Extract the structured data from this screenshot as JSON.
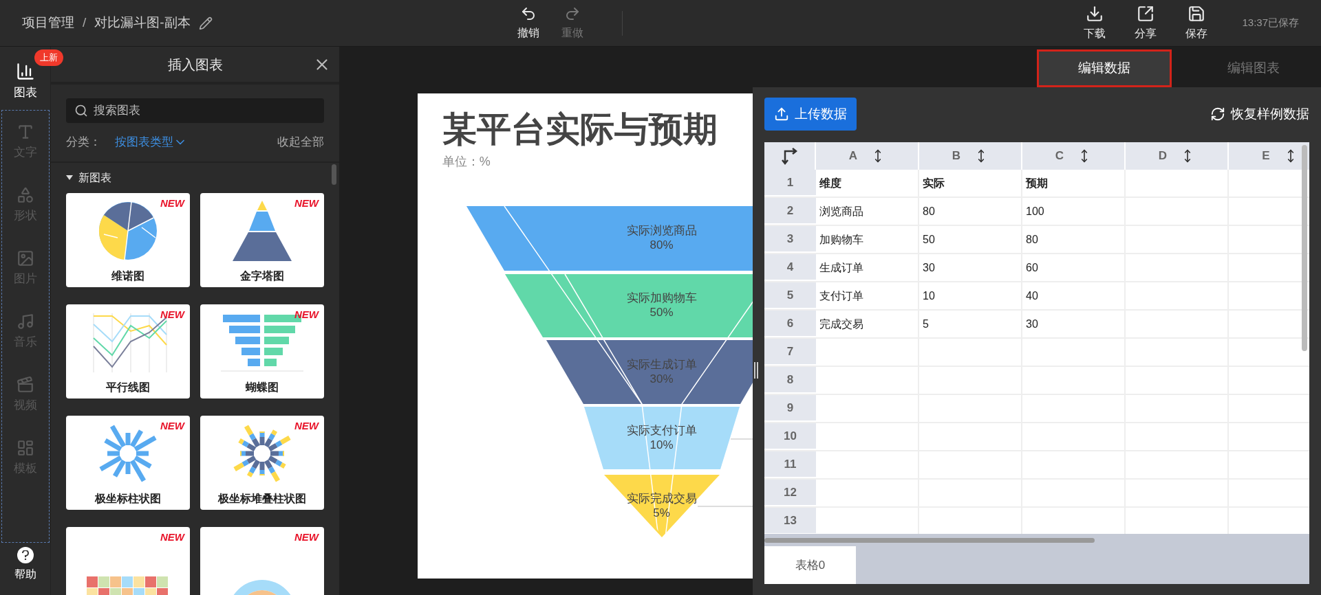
{
  "topbar": {
    "breadcrumb": [
      "项目管理",
      "对比漏斗图-副本"
    ],
    "separator": "/",
    "history": [
      {
        "label": "撤销",
        "disabled": false
      },
      {
        "label": "重做",
        "disabled": true
      }
    ],
    "actions": [
      "下载",
      "分享",
      "保存"
    ],
    "save_status": "13:37已保存"
  },
  "rail": {
    "badge": "上新",
    "items": [
      {
        "label": "图表",
        "selected": true
      },
      {
        "label": "文字",
        "selected": false
      },
      {
        "label": "形状",
        "selected": false
      },
      {
        "label": "图片",
        "selected": false
      },
      {
        "label": "音乐",
        "selected": false
      },
      {
        "label": "视频",
        "selected": false
      },
      {
        "label": "模板",
        "selected": false
      }
    ],
    "help": "帮助"
  },
  "panel": {
    "title": "插入图表",
    "search": {
      "placeholder": "搜索图表"
    },
    "category_label": "分类：",
    "category_value": "按图表类型",
    "collapse_all": "收起全部",
    "section": {
      "title": "新图表",
      "expanded": true,
      "cards": [
        {
          "title": "维诺图",
          "badge": "NEW"
        },
        {
          "title": "金字塔图",
          "badge": "NEW"
        },
        {
          "title": "平行线图",
          "badge": "NEW"
        },
        {
          "title": "蝴蝶图",
          "badge": "NEW"
        },
        {
          "title": "极坐标柱状图",
          "badge": "NEW"
        },
        {
          "title": "极坐标堆叠柱状图",
          "badge": "NEW"
        },
        {
          "badge": "NEW"
        },
        {
          "badge": "NEW"
        }
      ]
    }
  },
  "chart": {
    "title": "某平台实际与预期",
    "unit": "单位：%",
    "stages": [
      {
        "label": "实际浏览商品",
        "value": "80%",
        "color": "#58aaf0"
      },
      {
        "label": "实际加购物车",
        "value": "50%",
        "color": "#61d8a9"
      },
      {
        "label": "实际生成订单",
        "value": "30%",
        "color": "#5a6e99"
      },
      {
        "label": "实际支付订单",
        "value": "10%",
        "color": "#a6dcf9"
      },
      {
        "label": "实际完成交易",
        "value": "5%",
        "color": "#fdd94a"
      }
    ]
  },
  "editor_tabs": [
    {
      "label": "编辑数据",
      "selected": true
    },
    {
      "label": "编辑图表",
      "selected": false
    }
  ],
  "data_panel": {
    "upload": "上传数据",
    "restore": "恢复样例数据",
    "columns": [
      "A",
      "B",
      "C",
      "D",
      "E"
    ],
    "rows": [
      {
        "number": "1",
        "kind": "header",
        "cells": [
          "维度",
          "实际",
          "预期"
        ]
      },
      {
        "number": "2",
        "cells": [
          "浏览商品",
          "80",
          "100"
        ]
      },
      {
        "number": "3",
        "cells": [
          "加购物车",
          "50",
          "80"
        ]
      },
      {
        "number": "4",
        "cells": [
          "生成订单",
          "30",
          "60"
        ]
      },
      {
        "number": "5",
        "cells": [
          "支付订单",
          "10",
          "40"
        ]
      },
      {
        "number": "6",
        "cells": [
          "完成交易",
          "5",
          "30"
        ]
      },
      {
        "number": "7"
      },
      {
        "number": "8"
      },
      {
        "number": "9"
      },
      {
        "number": "10"
      },
      {
        "number": "11"
      },
      {
        "number": "12"
      },
      {
        "number": "13"
      }
    ],
    "sheets": [
      {
        "label": "表格0",
        "selected": true
      }
    ]
  }
}
